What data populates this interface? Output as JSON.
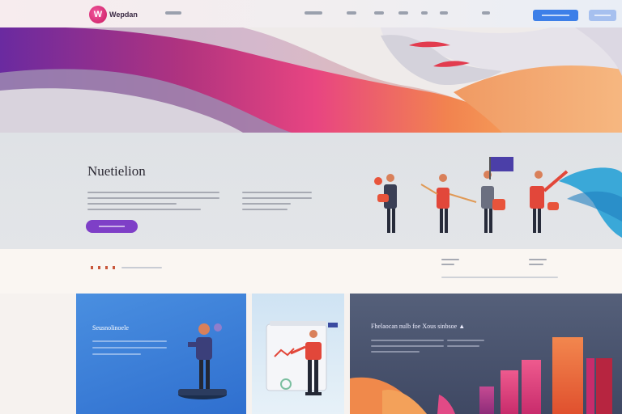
{
  "brand": {
    "logo_mark": "W",
    "logo_text": "Wepdan"
  },
  "icons": {
    "logo": "logo-icon"
  },
  "colors": {
    "brand_pink": "#d42571",
    "primary_blue": "#3d7fe8",
    "cta_purple": "#7e3fc7"
  },
  "feature": {
    "title": "Nuetielion"
  },
  "cards": [
    {
      "title": "Seusnolinoele"
    },
    {
      "title": ""
    },
    {
      "title": "Fhelaocan nulb foe  Xous sinbsoe ▲"
    }
  ]
}
